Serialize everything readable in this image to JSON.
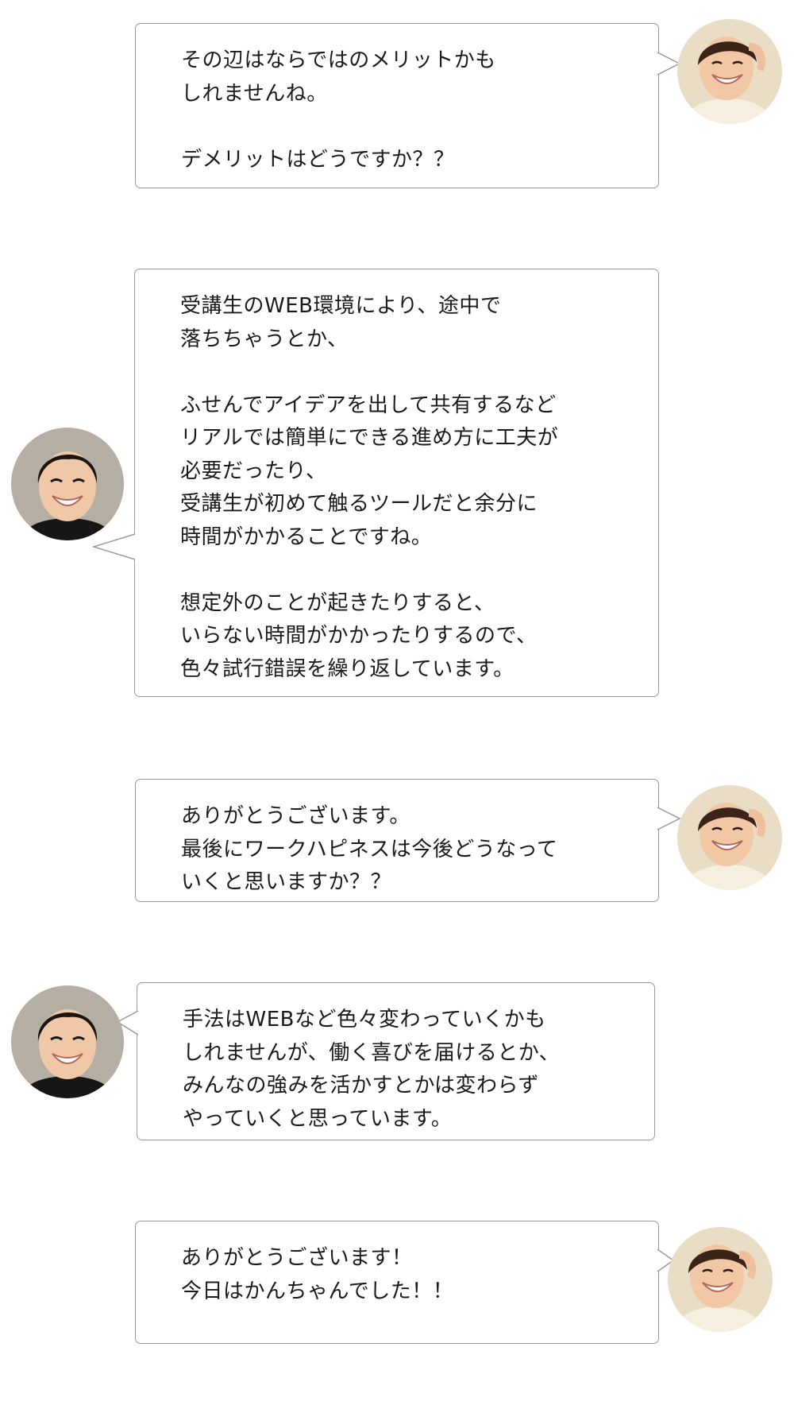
{
  "messages": [
    {
      "speaker": "interviewer",
      "text": "その辺はならではのメリットかも\nしれませんね。\n\nデメリットはどうですか？？"
    },
    {
      "speaker": "interviewee",
      "text": "受講生のWEB環境により、途中で\n落ちちゃうとか、\n\nふせんでアイデアを出して共有するなど\nリアルでは簡単にできる進め方に工夫が\n必要だったり、\n受講生が初めて触るツールだと余分に\n時間がかかることですね。\n\n想定外のことが起きたりすると、\nいらない時間がかかったりするので、\n色々試行錯誤を繰り返しています。"
    },
    {
      "speaker": "interviewer",
      "text": "ありがとうございます。\n最後にワークハピネスは今後どうなって\nいくと思いますか？？"
    },
    {
      "speaker": "interviewee",
      "text": "手法はWEBなど色々変わっていくかも\nしれませんが、働く喜びを届けるとか、\nみんなの強みを活かすとかは変わらず\nやっていくと思っています。"
    },
    {
      "speaker": "interviewer",
      "text": "ありがとうございます！\n今日はかんちゃんでした！！"
    }
  ],
  "colors": {
    "bubble_border": "#9a9a9a",
    "bubble_background": "#ffffff",
    "text": "#1a1a1a",
    "background": "#ffffff"
  },
  "icons": {
    "interviewer_avatar": "interviewer-avatar-photo",
    "interviewee_avatar": "interviewee-avatar-photo"
  }
}
